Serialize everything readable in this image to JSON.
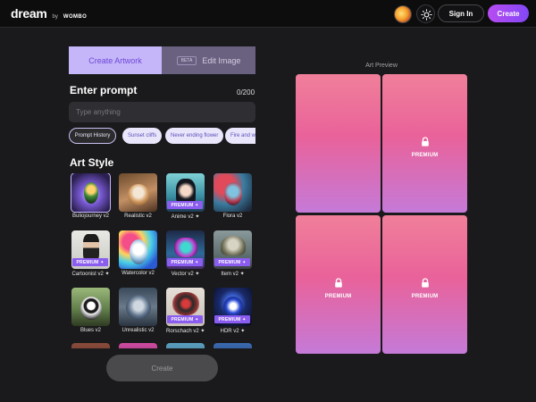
{
  "header": {
    "logo": "dream",
    "logo_by": "by",
    "logo_brand": "WOMBO",
    "signin_label": "Sign In",
    "create_label": "Create"
  },
  "tabs": {
    "create_artwork": "Create Artwork",
    "beta_badge": "BETA",
    "edit_image": "Edit Image"
  },
  "prompt": {
    "title": "Enter prompt",
    "count": "0/200",
    "placeholder": "Type anything"
  },
  "chips": [
    {
      "label": "Prompt History"
    },
    {
      "label": "Sunset cliffs"
    },
    {
      "label": "Never ending flower"
    },
    {
      "label": "Fire and w"
    }
  ],
  "art_style": {
    "title": "Art Style",
    "premium_badge": "PREMIUM ✦",
    "items": [
      {
        "label": "Buliojourney v2",
        "premium": false,
        "selected": true
      },
      {
        "label": "Realistic v2",
        "premium": false
      },
      {
        "label": "Anime v2 ✦",
        "premium": true
      },
      {
        "label": "Flora v2",
        "premium": false
      },
      {
        "label": "Cartoonist v2 ✦",
        "premium": true
      },
      {
        "label": "Watercolor v2",
        "premium": false
      },
      {
        "label": "Vector v2 ✦",
        "premium": true
      },
      {
        "label": "Item v2 ✦",
        "premium": true
      },
      {
        "label": "Blues v2",
        "premium": false
      },
      {
        "label": "Unrealistic v2",
        "premium": false
      },
      {
        "label": "Rorschach v2 ✦",
        "premium": true
      },
      {
        "label": "HDR v2 ✦",
        "premium": true
      }
    ]
  },
  "create_button": "Create",
  "preview": {
    "label": "Art Preview",
    "tile_label": "PREMIUM"
  },
  "colors": {
    "accent": "#8a5cf0",
    "tab_active_bg": "#c5b5f9",
    "create_gradient_start": "#b84cf2",
    "create_gradient_end": "#8247f5"
  },
  "icons": {
    "theme": "sun-icon",
    "lock": "lock-icon"
  }
}
